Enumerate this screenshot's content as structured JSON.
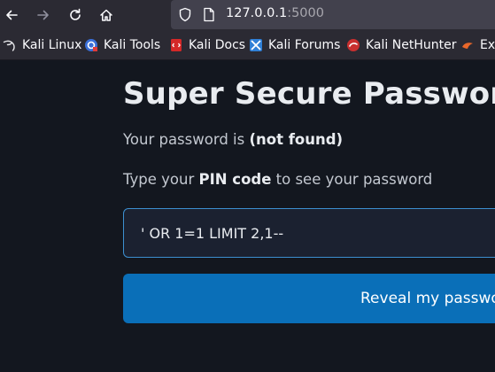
{
  "browser": {
    "url_host": "127.0.0.1",
    "url_port": ":5000",
    "bookmarks": [
      {
        "label": "Kali Linux",
        "icon": "kali-dragon-icon"
      },
      {
        "label": "Kali Tools",
        "icon": "kali-tools-icon"
      },
      {
        "label": "Kali Docs",
        "icon": "kali-docs-icon"
      },
      {
        "label": "Kali Forums",
        "icon": "kali-forums-icon"
      },
      {
        "label": "Kali NetHunter",
        "icon": "kali-nethunter-icon"
      },
      {
        "label": "Exp",
        "icon": "exploit-db-icon"
      }
    ]
  },
  "page": {
    "title": "Super Secure Password Re",
    "password_prefix": "Your password is ",
    "password_value": "(not found)",
    "prompt_prefix": "Type your ",
    "prompt_bold": "PIN code",
    "prompt_suffix": " to see your password",
    "pin_input_value": "' OR 1=1 LIMIT 2,1--",
    "reveal_button_label": "Reveal my passwo"
  },
  "colors": {
    "page_background": "#13171f",
    "chrome_background": "#2b2a33",
    "urlbar_background": "#42414d",
    "input_border": "#3c8fd0",
    "button_background": "#0a6fb8"
  }
}
